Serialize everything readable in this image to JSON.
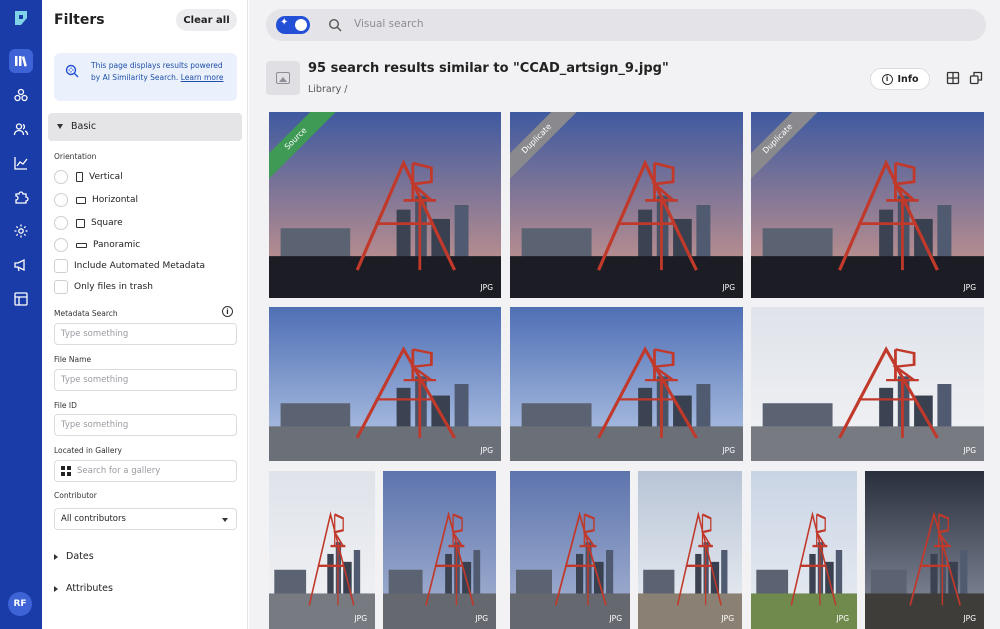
{
  "rail": {
    "avatar": "RF"
  },
  "filters": {
    "title": "Filters",
    "clear_all": "Clear all",
    "info_text": "This page displays results powered by AI Similarity Search.",
    "info_link": "Learn more",
    "basic_section": "Basic",
    "orientation_label": "Orientation",
    "orientations": [
      "Vertical",
      "Horizontal",
      "Square",
      "Panoramic"
    ],
    "include_automated": "Include Automated Metadata",
    "only_trash": "Only files in trash",
    "metadata_search_label": "Metadata Search",
    "metadata_search_placeholder": "Type something",
    "file_name_label": "File Name",
    "file_name_placeholder": "Type something",
    "file_id_label": "File ID",
    "file_id_placeholder": "Type something",
    "gallery_label": "Located in Gallery",
    "gallery_placeholder": "Search for a gallery",
    "contributor_label": "Contributor",
    "contributor_value": "All contributors",
    "dates": "Dates",
    "attributes": "Attributes"
  },
  "search": {
    "placeholder": "Visual search"
  },
  "results": {
    "title": "95 search results similar to \"CCAD_artsign_9.jpg\"",
    "breadcrumb": "Library /",
    "info_button": "Info"
  },
  "tiles": [
    {
      "format": "JPG",
      "badge": "Source"
    },
    {
      "format": "JPG",
      "badge": "Duplicate"
    },
    {
      "format": "JPG",
      "badge": "Duplicate"
    },
    {
      "format": "JPG",
      "badge": ""
    },
    {
      "format": "JPG",
      "badge": ""
    },
    {
      "format": "JPG",
      "badge": ""
    },
    {
      "format": "JPG",
      "badge": ""
    },
    {
      "format": "JPG",
      "badge": ""
    },
    {
      "format": "JPG",
      "badge": ""
    },
    {
      "format": "JPG",
      "badge": ""
    },
    {
      "format": "JPG",
      "badge": ""
    },
    {
      "format": "JPG",
      "badge": ""
    }
  ],
  "colors": {
    "rail": "#1a3ca8",
    "accent": "#2350d6",
    "source_badge": "#3f9a55",
    "duplicate_badge": "#8a8a8e"
  }
}
